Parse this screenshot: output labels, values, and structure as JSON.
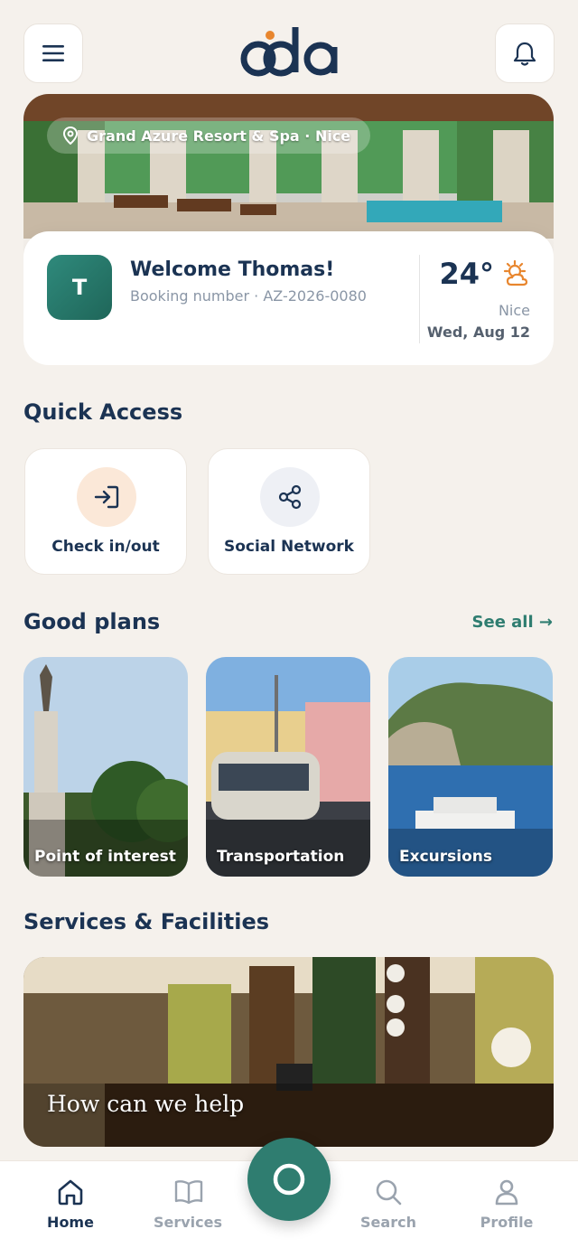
{
  "header": {
    "logo_text": "oda",
    "menu_icon": "hamburger-icon",
    "notification_icon": "bell-icon"
  },
  "hero": {
    "location": "Grand Azure Resort & Spa · Nice",
    "location_icon": "pin-icon"
  },
  "welcome": {
    "avatar_initial": "T",
    "title": "Welcome Thomas!",
    "booking": "Booking number · AZ-2026-0080",
    "temperature": "24°",
    "weather_icon": "sun-cloud-icon",
    "city": "Nice",
    "date": "Wed, Aug 12"
  },
  "quick_access": {
    "title": "Quick Access",
    "items": [
      {
        "label": "Check in/out",
        "icon": "sign-in-icon"
      },
      {
        "label": "Social Network",
        "icon": "share-icon"
      }
    ]
  },
  "good_plans": {
    "title": "Good plans",
    "see_all": "See all →",
    "items": [
      {
        "label": "Point of interest"
      },
      {
        "label": "Transportation"
      },
      {
        "label": "Excursions"
      }
    ]
  },
  "services": {
    "title": "Services & Facilities",
    "banner_text": "How can we help"
  },
  "nav": {
    "items": [
      {
        "label": "Home",
        "icon": "home-icon",
        "active": true
      },
      {
        "label": "Services",
        "icon": "book-icon"
      },
      {
        "label": "Search",
        "icon": "search-icon"
      },
      {
        "label": "Profile",
        "icon": "user-icon"
      }
    ],
    "fab_icon": "circle-icon"
  },
  "colors": {
    "background": "#f5f1ec",
    "primary": "#1b3353",
    "accent": "#2f7d70",
    "orange": "#e8862e"
  }
}
